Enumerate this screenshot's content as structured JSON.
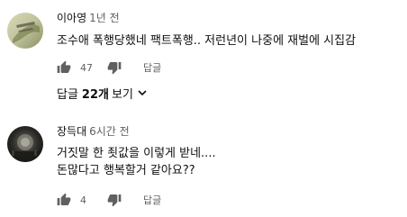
{
  "comments": [
    {
      "author": "이아영",
      "time": "1년 전",
      "lines": [
        "조수애 폭행당했네 팩트폭행.. 저런년이 나중에 재벌에 시집감"
      ],
      "likes": "47",
      "reply_label": "답글",
      "view_replies": {
        "prefix": "답글",
        "count": "22개",
        "suffix": "보기"
      }
    },
    {
      "author": "장득대",
      "time": "6시간 전",
      "lines": [
        "거짓말 한 죗값을 이렇게 받네....",
        "돈많다고 행복할거 같아요??"
      ],
      "likes": "4",
      "reply_label": "답글"
    }
  ],
  "icons": {
    "like": "thumb-up-icon",
    "dislike": "thumb-down-icon",
    "expand": "chevron-down-icon"
  },
  "colors": {
    "text": "#0f0f0f",
    "meta": "#606060",
    "icon": "#606060"
  }
}
